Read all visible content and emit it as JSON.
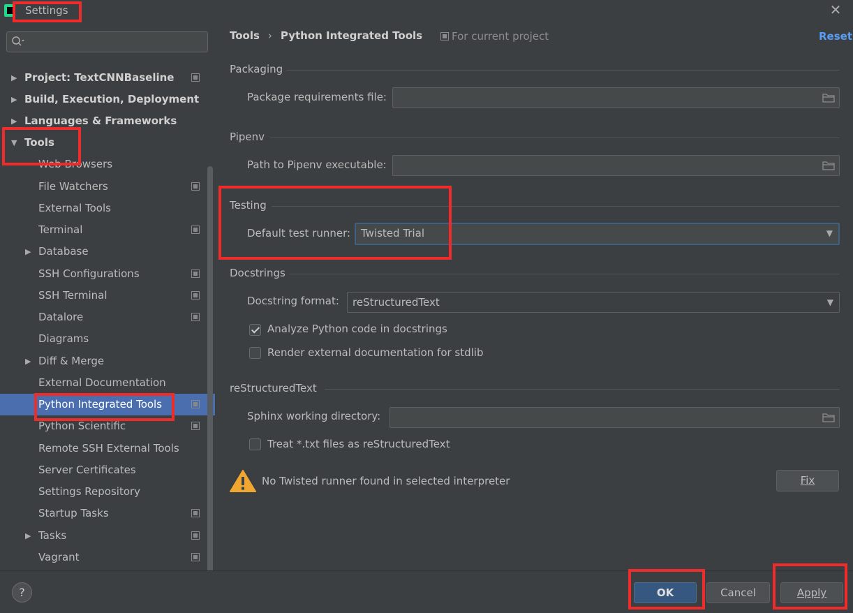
{
  "window": {
    "title": "Settings"
  },
  "sidebar": {
    "search_placeholder": "",
    "items": [
      {
        "label": "Project: TextCNNBaseline",
        "bold": true,
        "arrow": "▶",
        "has_project_icon": true
      },
      {
        "label": "Build, Execution, Deployment",
        "bold": true,
        "arrow": "▶",
        "has_project_icon": false
      },
      {
        "label": "Languages & Frameworks",
        "bold": true,
        "arrow": "▶",
        "has_project_icon": false
      },
      {
        "label": "Tools",
        "bold": true,
        "arrow": "▼",
        "has_project_icon": false
      },
      {
        "label": "Web Browsers",
        "bold": false,
        "arrow": "",
        "has_project_icon": false
      },
      {
        "label": "File Watchers",
        "bold": false,
        "arrow": "",
        "has_project_icon": true
      },
      {
        "label": "External Tools",
        "bold": false,
        "arrow": "",
        "has_project_icon": false
      },
      {
        "label": "Terminal",
        "bold": false,
        "arrow": "",
        "has_project_icon": true
      },
      {
        "label": "Database",
        "bold": false,
        "arrow": "▶",
        "has_project_icon": false
      },
      {
        "label": "SSH Configurations",
        "bold": false,
        "arrow": "",
        "has_project_icon": true
      },
      {
        "label": "SSH Terminal",
        "bold": false,
        "arrow": "",
        "has_project_icon": true
      },
      {
        "label": "Datalore",
        "bold": false,
        "arrow": "",
        "has_project_icon": true
      },
      {
        "label": "Diagrams",
        "bold": false,
        "arrow": "",
        "has_project_icon": false
      },
      {
        "label": "Diff & Merge",
        "bold": false,
        "arrow": "▶",
        "has_project_icon": false
      },
      {
        "label": "External Documentation",
        "bold": false,
        "arrow": "",
        "has_project_icon": false
      },
      {
        "label": "Python Integrated Tools",
        "bold": false,
        "arrow": "",
        "has_project_icon": true,
        "selected": true
      },
      {
        "label": "Python Scientific",
        "bold": false,
        "arrow": "",
        "has_project_icon": true
      },
      {
        "label": "Remote SSH External Tools",
        "bold": false,
        "arrow": "",
        "has_project_icon": false
      },
      {
        "label": "Server Certificates",
        "bold": false,
        "arrow": "",
        "has_project_icon": false
      },
      {
        "label": "Settings Repository",
        "bold": false,
        "arrow": "",
        "has_project_icon": false
      },
      {
        "label": "Startup Tasks",
        "bold": false,
        "arrow": "",
        "has_project_icon": true
      },
      {
        "label": "Tasks",
        "bold": false,
        "arrow": "▶",
        "has_project_icon": true
      },
      {
        "label": "Vagrant",
        "bold": false,
        "arrow": "",
        "has_project_icon": true
      }
    ]
  },
  "main": {
    "breadcrumb": {
      "parent": "Tools",
      "separator": "›",
      "current": "Python Integrated Tools"
    },
    "for_current_project": "For current project",
    "reset": "Reset",
    "packaging": {
      "title": "Packaging",
      "requirements_label": "Package requirements file:",
      "requirements_value": ""
    },
    "pipenv": {
      "title": "Pipenv",
      "path_label": "Path to Pipenv executable:",
      "path_value": ""
    },
    "testing": {
      "title": "Testing",
      "runner_label": "Default test runner:",
      "runner_value": "Twisted Trial"
    },
    "docstrings": {
      "title": "Docstrings",
      "format_label": "Docstring format:",
      "format_value": "reStructuredText",
      "analyze_label": "Analyze Python code in docstrings",
      "analyze_checked": true,
      "render_label": "Render external documentation for stdlib",
      "render_checked": false
    },
    "restructuredtext": {
      "title": "reStructuredText",
      "sphinx_label": "Sphinx working directory:",
      "sphinx_value": "",
      "treat_label": "Treat *.txt files as reStructuredText",
      "treat_checked": false
    },
    "warning": {
      "text": "No Twisted runner found in selected interpreter",
      "fix_label": "Fix"
    }
  },
  "footer": {
    "help": "?",
    "ok": "OK",
    "cancel": "Cancel",
    "apply": "Apply"
  },
  "colors": {
    "background": "#3c3f41",
    "selection": "#4b6eaf",
    "accent_link": "#589df6",
    "annotation": "#ee2c2c",
    "warning": "#f0a732"
  }
}
